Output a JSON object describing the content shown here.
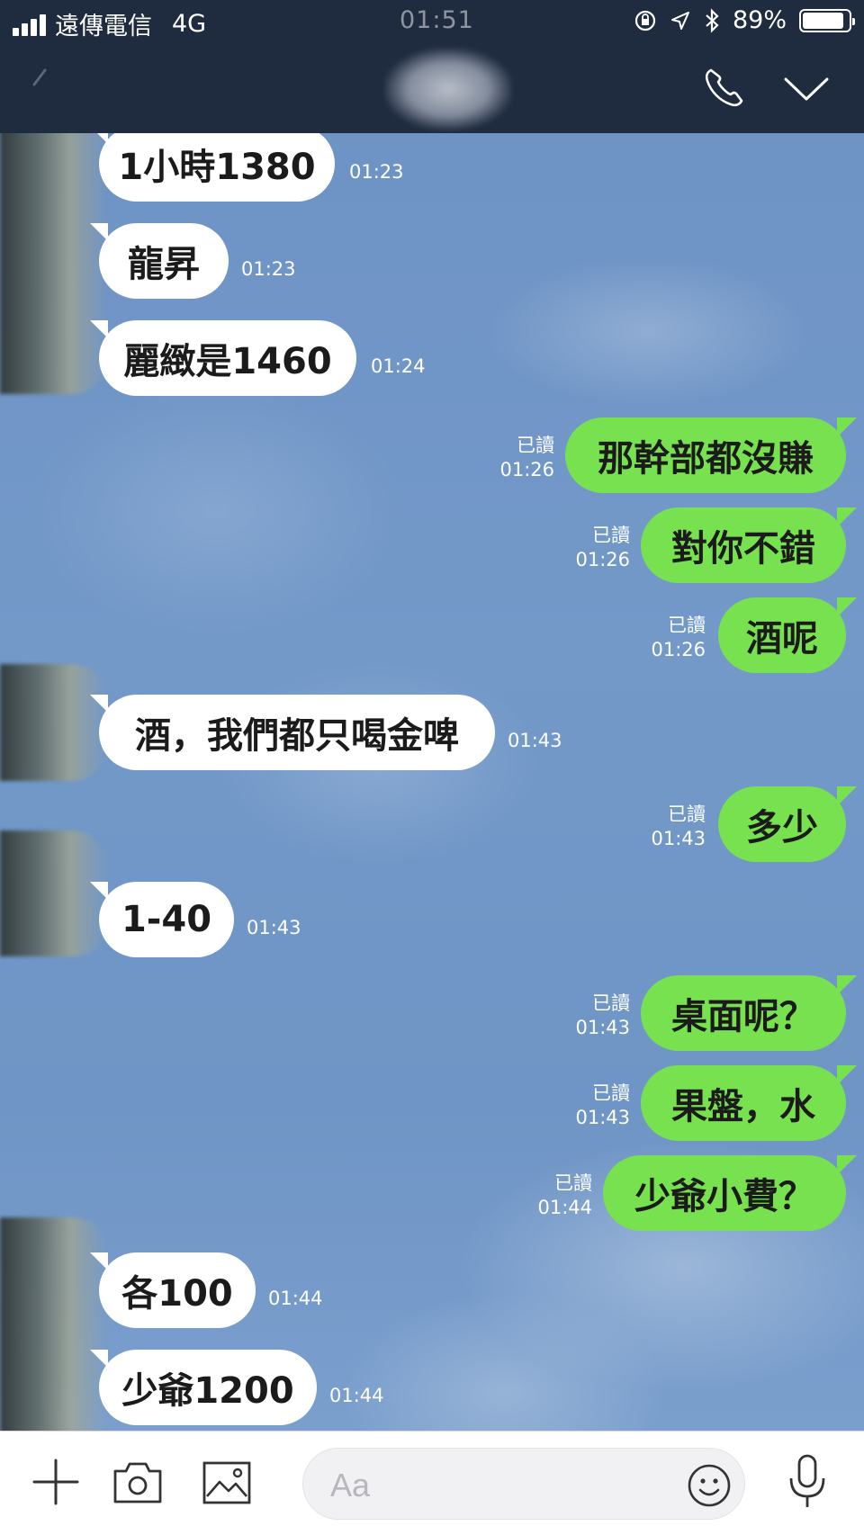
{
  "status_bar": {
    "carrier": "遠傳電信",
    "network": "4G",
    "time": "01:51",
    "battery_percent": "89%",
    "battery_level": 0.89
  },
  "header": {
    "call_icon": "phone-icon",
    "menu_icon": "chevron-down-icon"
  },
  "colors": {
    "header_bg": "#1f2b3f",
    "outgoing_bubble": "#78e150",
    "incoming_bubble": "#ffffff",
    "chat_bg": "#6f93c4"
  },
  "messages": [
    {
      "dir": "in",
      "text": "1小時1380",
      "time": "01:23"
    },
    {
      "dir": "in",
      "text": "龍昇",
      "time": "01:23"
    },
    {
      "dir": "in",
      "text": "麗緻是1460",
      "time": "01:24"
    },
    {
      "dir": "out",
      "text": "那幹部都沒賺",
      "read": "已讀",
      "time": "01:26"
    },
    {
      "dir": "out",
      "text": "對你不錯",
      "read": "已讀",
      "time": "01:26"
    },
    {
      "dir": "out",
      "text": "酒呢",
      "read": "已讀",
      "time": "01:26"
    },
    {
      "dir": "in",
      "text": "酒，我們都只喝金啤",
      "time": "01:43"
    },
    {
      "dir": "out",
      "text": "多少",
      "read": "已讀",
      "time": "01:43"
    },
    {
      "dir": "in",
      "text": "1-40",
      "time": "01:43"
    },
    {
      "dir": "out",
      "text": "桌面呢？",
      "read": "已讀",
      "time": "01:43"
    },
    {
      "dir": "out",
      "text": "果盤，水",
      "read": "已讀",
      "time": "01:43"
    },
    {
      "dir": "out",
      "text": "少爺小費？",
      "read": "已讀",
      "time": "01:44"
    },
    {
      "dir": "in",
      "text": "各100",
      "time": "01:44"
    },
    {
      "dir": "in",
      "text": "少爺1200",
      "time": "01:44"
    }
  ],
  "input_bar": {
    "placeholder": "Aa",
    "icons": [
      "plus-icon",
      "camera-icon",
      "image-icon",
      "emoji-icon",
      "microphone-icon"
    ]
  }
}
